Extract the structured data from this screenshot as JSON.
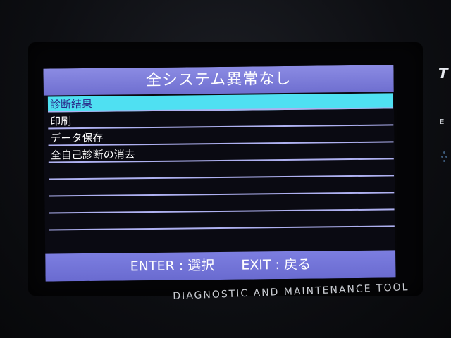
{
  "screen": {
    "title": "全システム異常なし",
    "menu_items": [
      {
        "label": "診断結果",
        "selected": true
      },
      {
        "label": "印刷",
        "selected": false
      },
      {
        "label": "データ保存",
        "selected": false
      },
      {
        "label": "全自己診断の消去",
        "selected": false
      },
      {
        "label": "",
        "selected": false
      },
      {
        "label": "",
        "selected": false
      },
      {
        "label": "",
        "selected": false
      },
      {
        "label": "",
        "selected": false
      }
    ],
    "footer": {
      "enter_hint": "ENTER : 選択",
      "exit_hint": "EXIT : 戻る"
    }
  },
  "device": {
    "brand_text": "DIAGNOSTIC AND MAINTENANCE TOOL",
    "side_letter_top": "T",
    "side_letter_mid": "E"
  },
  "colors": {
    "title_bar": "#7c7ee0",
    "selected_row": "#4fe0f2",
    "row_divider": "#aeb0f0",
    "screen_bg": "#0a0a12"
  }
}
